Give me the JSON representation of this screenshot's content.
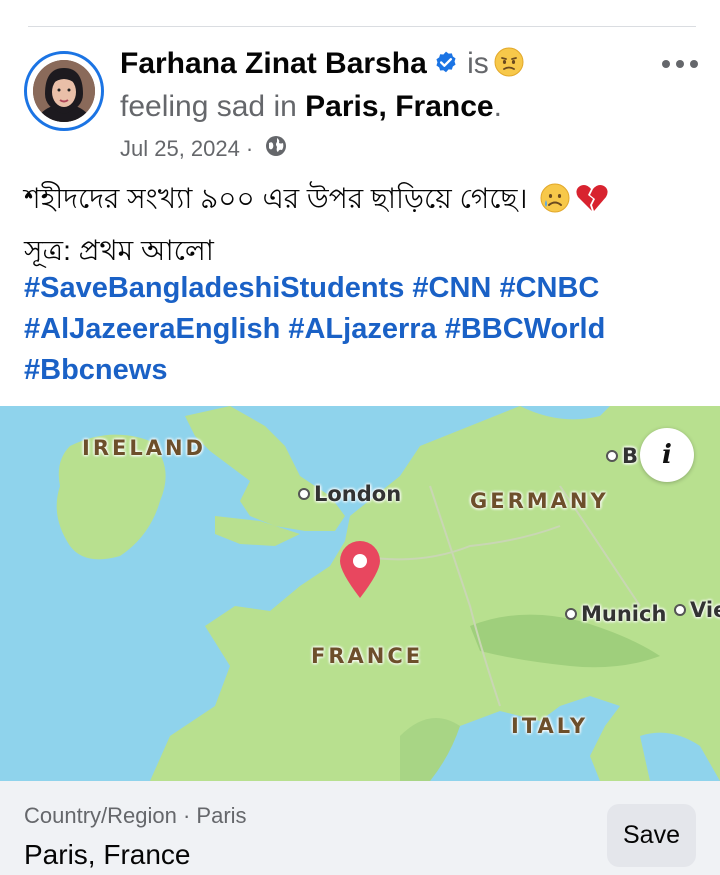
{
  "post": {
    "author": "Farhana Zinat Barsha",
    "is_text": "is",
    "feeling_text": "feeling sad in ",
    "location": "Paris, France",
    "period": ".",
    "date": "Jul 25, 2024",
    "separator": "·",
    "body_line1": "শহীদদের সংখ্যা ৯০০ এর উপর ছাড়িয়ে গেছে।",
    "body_line2": "সূত্র: প্রথম আলো",
    "hashtags": [
      "#SaveBangladeshiStudents",
      "#CNN",
      "#CNBC",
      "#AlJazeeraEnglish",
      "#ALjazerra",
      "#BBCWorld",
      "#Bbcnews"
    ]
  },
  "icons": {
    "verified": "verified-badge-icon",
    "feeling": "sad-face-emoji",
    "privacy": "globe-icon",
    "more": "more-options-icon",
    "crying": "crying-face-emoji",
    "broken_heart": "broken-heart-emoji",
    "map_info": "info-icon",
    "map_pin": "location-pin-icon"
  },
  "map": {
    "labels": {
      "ireland": "IRELAND",
      "germany": "GERMANY",
      "france": "FRANCE",
      "italy": "ITALY"
    },
    "cities": {
      "london": "London",
      "munich": "Munich",
      "vienna": "Vie",
      "berlin": "B"
    },
    "info_symbol": "i"
  },
  "footer": {
    "subtitle": "Country/Region · Paris",
    "title": "Paris, France",
    "save_label": "Save"
  },
  "colors": {
    "link": "#1a61c6",
    "verified": "#1b74e4",
    "pin": "#e8475f",
    "water": "#8fd3ec",
    "land": "#b8e08f"
  }
}
